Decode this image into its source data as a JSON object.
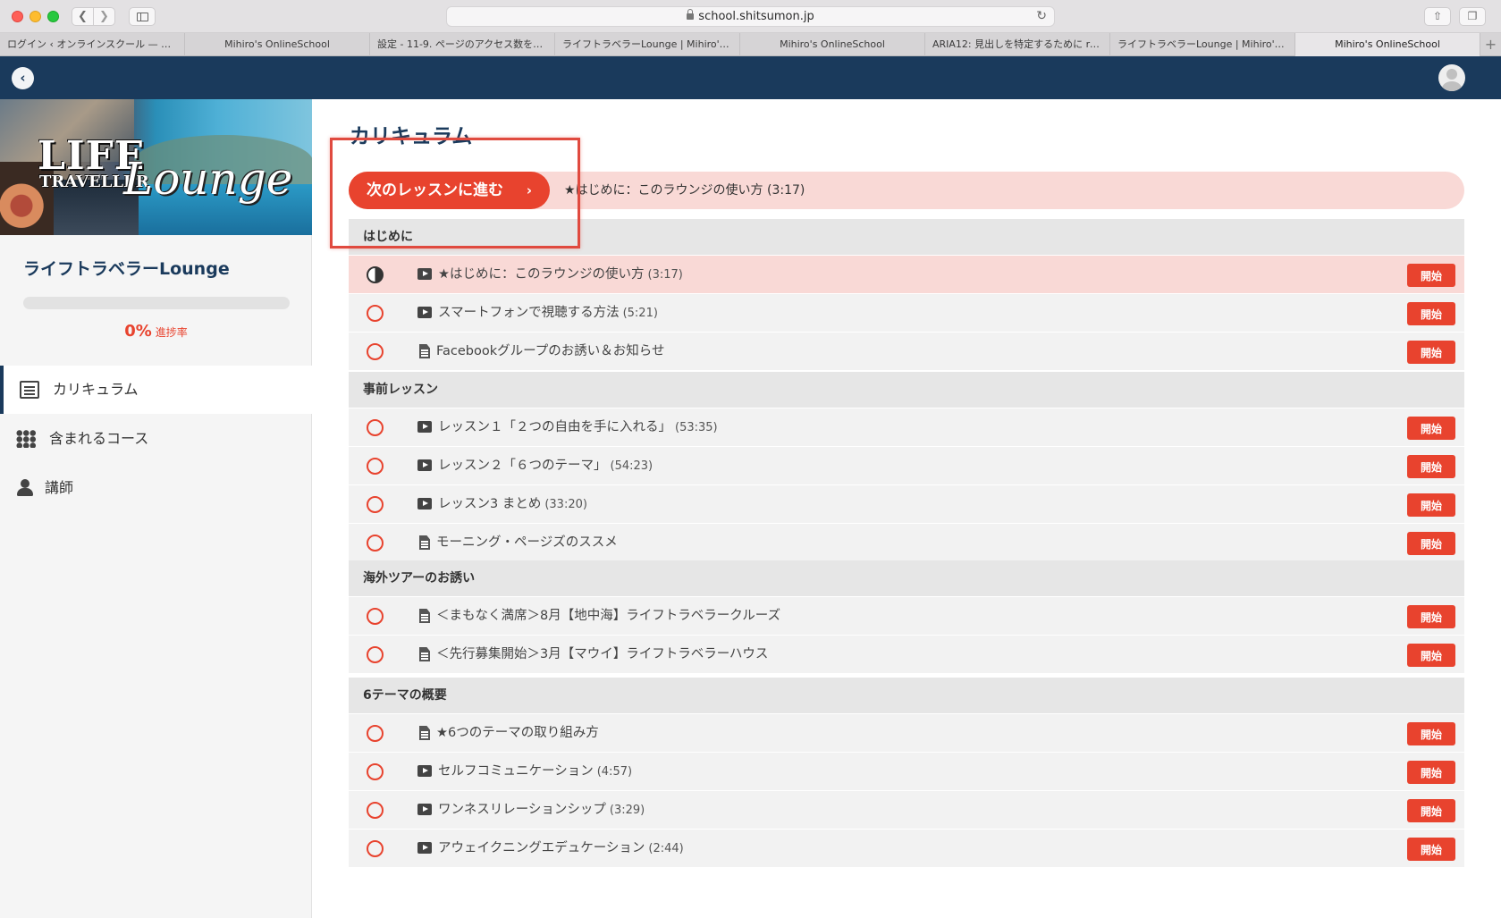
{
  "browser": {
    "url": "school.shitsumon.jp",
    "tabs": [
      "ログイン ‹ オンラインスクール — Wo...",
      "Mihiro's OnlineSchool",
      "設定 - 11-9. ページのアクセス数を調...",
      "ライフトラベラーLounge | Mihiro's...",
      "Mihiro's OnlineSchool",
      "ARIA12: 見出しを特定するために rol...",
      "ライフトラベラーLounge | Mihiro's...",
      "Mihiro's OnlineSchool"
    ],
    "active_tab": 7
  },
  "sidebar": {
    "banner_text": {
      "life": "LIFE",
      "traveller": "TRAVELLER",
      "lounge": "Lounge"
    },
    "course_title": "ライフトラベラーLounge",
    "progress_percent": "0%",
    "progress_label": "進捗率",
    "progress_value": 0,
    "menu": [
      {
        "label": "カリキュラム",
        "icon": "list-icon",
        "active": true
      },
      {
        "label": "含まれるコース",
        "icon": "grid-icon",
        "active": false
      },
      {
        "label": "講師",
        "icon": "user-icon",
        "active": false
      }
    ]
  },
  "main": {
    "title": "カリキュラム",
    "next_button_label": "次のレッスンに進む",
    "next_button_chevron": "›",
    "next_lesson_title": "★はじめに：このラウンジの使い方 (3:17)",
    "start_label": "開始",
    "sections": [
      {
        "title": "はじめに",
        "lessons": [
          {
            "type": "video",
            "title": "★はじめに：このラウンジの使い方",
            "duration": "(3:17)",
            "status": "in-progress"
          },
          {
            "type": "video",
            "title": "スマートフォンで視聴する方法",
            "duration": "(5:21)",
            "status": "not-started"
          },
          {
            "type": "doc",
            "title": "Facebookグループのお誘い＆お知らせ",
            "duration": "",
            "status": "not-started"
          }
        ]
      },
      {
        "title": "事前レッスン",
        "lessons": [
          {
            "type": "video",
            "title": "レッスン１「２つの自由を手に入れる」",
            "duration": "(53:35)",
            "status": "not-started"
          },
          {
            "type": "video",
            "title": "レッスン２「６つのテーマ」",
            "duration": "(54:23)",
            "status": "not-started"
          },
          {
            "type": "video",
            "title": "レッスン3 まとめ",
            "duration": "(33:20)",
            "status": "not-started"
          },
          {
            "type": "doc",
            "title": "モーニング・ページズのススメ",
            "duration": "",
            "status": "not-started"
          }
        ]
      },
      {
        "title": "海外ツアーのお誘い",
        "lessons": [
          {
            "type": "doc",
            "title": "＜まもなく満席＞8月【地中海】ライフトラベラークルーズ",
            "duration": "",
            "status": "not-started"
          },
          {
            "type": "doc",
            "title": "＜先行募集開始＞3月【マウイ】ライフトラベラーハウス",
            "duration": "",
            "status": "not-started"
          }
        ]
      },
      {
        "title": "6テーマの概要",
        "lessons": [
          {
            "type": "doc",
            "title": "★6つのテーマの取り組み方",
            "duration": "",
            "status": "not-started"
          },
          {
            "type": "video",
            "title": "セルフコミュニケーション",
            "duration": "(4:57)",
            "status": "not-started"
          },
          {
            "type": "video",
            "title": "ワンネスリレーションシップ",
            "duration": "(3:29)",
            "status": "not-started"
          },
          {
            "type": "video",
            "title": "アウェイクニングエデュケーション",
            "duration": "(2:44)",
            "status": "not-started"
          }
        ]
      }
    ]
  },
  "colors": {
    "header_navy": "#1a3a5c",
    "accent_red": "#e8432e",
    "highlight_pink": "#f9d9d6",
    "annotation_box": "#e04a3f"
  }
}
